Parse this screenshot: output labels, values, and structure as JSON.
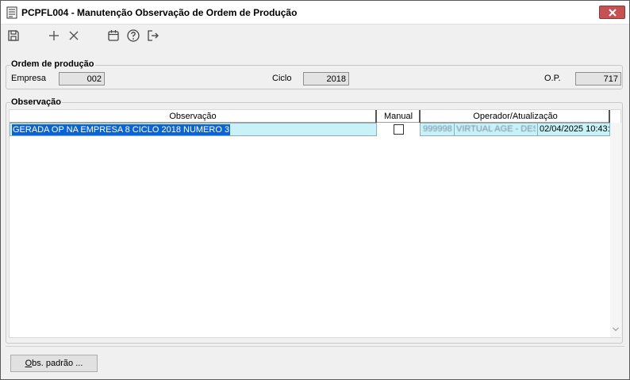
{
  "window": {
    "title": "PCPFL004 - Manutenção Observação de Ordem de Produção"
  },
  "toolbar": {
    "icons": [
      "save-icon",
      "add-icon",
      "delete-icon",
      "calendar-icon",
      "help-icon",
      "exit-icon"
    ]
  },
  "ordem_producao": {
    "group_label": "Ordem de produção",
    "empresa_label": "Empresa",
    "empresa_value": "002",
    "ciclo_label": "Ciclo",
    "ciclo_value": "2018",
    "op_label": "O.P.",
    "op_value": "717"
  },
  "observacao": {
    "group_label": "Observação",
    "columns": [
      "Observação",
      "Manual",
      "Operador/Atualização"
    ],
    "rows": [
      {
        "observacao": "GERADA OP NA EMPRESA 8 CICLO 2018 NUMERO 3",
        "manual": false,
        "operador_codigo": "999998",
        "operador_nome": "VIRTUAL AGE - DESE",
        "atualizacao": "02/04/2025 10:43:"
      }
    ]
  },
  "footer": {
    "obs_padrao_prefix": "O",
    "obs_padrao_rest": "bs. padrão ..."
  },
  "colors": {
    "selection": "#0a64d8",
    "row_highlight": "#c8f1f8",
    "close_button": "#c75050"
  }
}
